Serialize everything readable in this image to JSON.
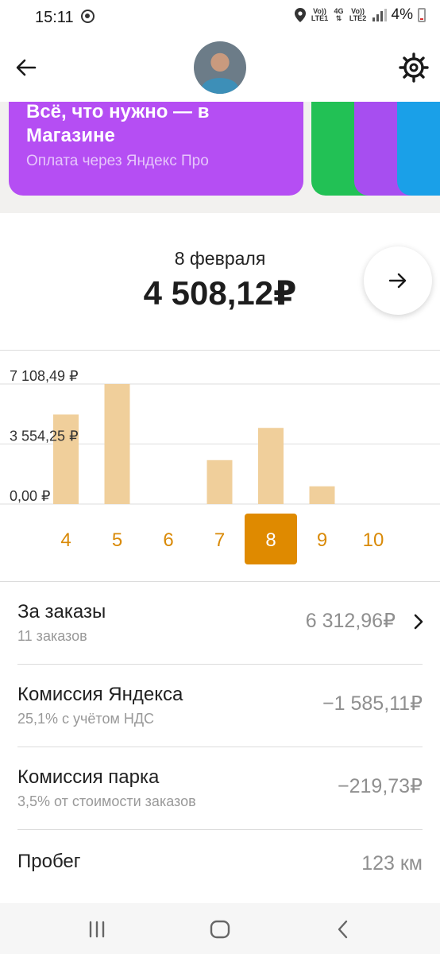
{
  "status_bar": {
    "time": "15:11",
    "net1_top": "Vo)) LTE1",
    "net1_gen": "4G",
    "net2_top": "Vo)) LTE2",
    "battery": "4%"
  },
  "promo": {
    "title": "Всё, что нужно — в Магазине",
    "subtitle": "Оплата через Яндекс Про",
    "card_color": "#b54ef3",
    "stack_colors": [
      "#22c155",
      "#a74ef0",
      "#1aa0e8"
    ]
  },
  "summary": {
    "date": "8 февраля",
    "amount": "4 508,12₽"
  },
  "chart_data": {
    "type": "bar",
    "categories": [
      "4",
      "5",
      "6",
      "7",
      "8",
      "9",
      "10"
    ],
    "values": [
      5300,
      7108.49,
      0,
      2600,
      4508.12,
      1050,
      0
    ],
    "selected": "8",
    "y_ticks": [
      "7 108,49 ₽",
      "3 554,25 ₽",
      "0,00 ₽"
    ],
    "y_tick_values": [
      7108.49,
      3554.25,
      0
    ],
    "ylim": [
      0,
      7108.49
    ],
    "bar_color": "#f0cf9b",
    "selected_color": "#df8a00",
    "label_color": "#d98a08"
  },
  "rows": [
    {
      "title": "За заказы",
      "subtitle": "11 заказов",
      "value": "6 312,96₽",
      "chevron": true
    },
    {
      "title": "Комиссия Яндекса",
      "subtitle": "25,1% с учётом НДС",
      "value": "−1 585,11₽",
      "chevron": false
    },
    {
      "title": "Комиссия парка",
      "subtitle": "3,5% от стоимости заказов",
      "value": "−219,73₽",
      "chevron": false
    },
    {
      "title": "Пробег",
      "subtitle": "",
      "value": "123 км",
      "chevron": false
    }
  ]
}
